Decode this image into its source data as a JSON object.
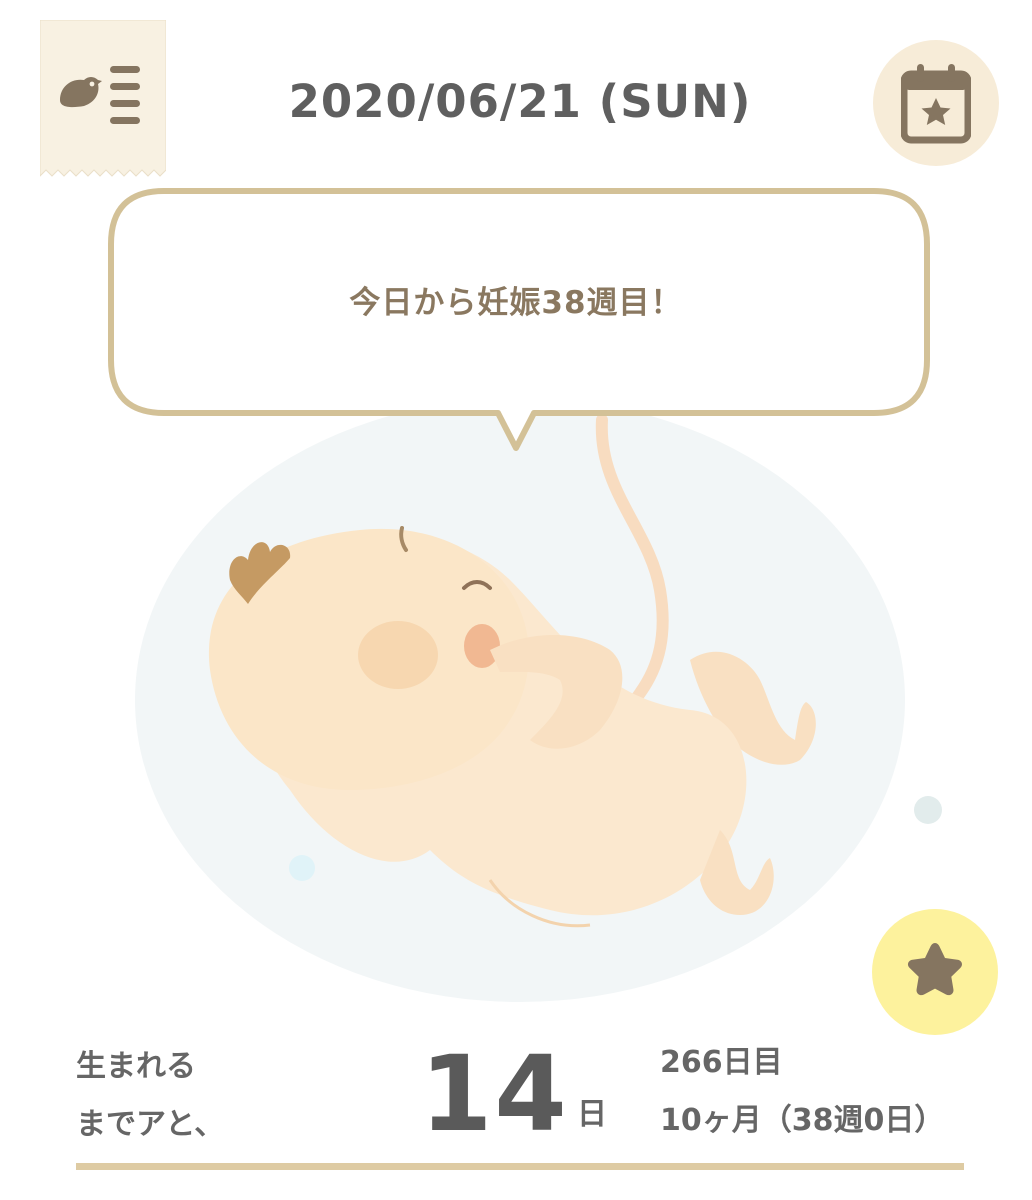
{
  "header": {
    "date": "2020/06/21 (SUN)",
    "menu_icon": "bird-list-icon",
    "calendar_icon": "calendar-star-icon"
  },
  "message": {
    "text": "今日から妊娠38週目！"
  },
  "illustration": {
    "icon": "fetus-illustration"
  },
  "favorite": {
    "icon": "star-icon"
  },
  "countdown": {
    "label_line1": "生まれる",
    "label_line2": "までアと、",
    "days": "14",
    "unit": "日"
  },
  "progress": {
    "day_count": "266日目",
    "month_week": "10ヶ月（38週0日）"
  },
  "colors": {
    "accent_gold": "#d3c197",
    "bubble_text": "#8a7860",
    "menu_tag_bg": "#f8f1e2",
    "calendar_bg": "#f7ecd8",
    "favorite_bg": "#fdf29d",
    "icon_brown": "#857560",
    "skin": "#fbe6c8"
  }
}
